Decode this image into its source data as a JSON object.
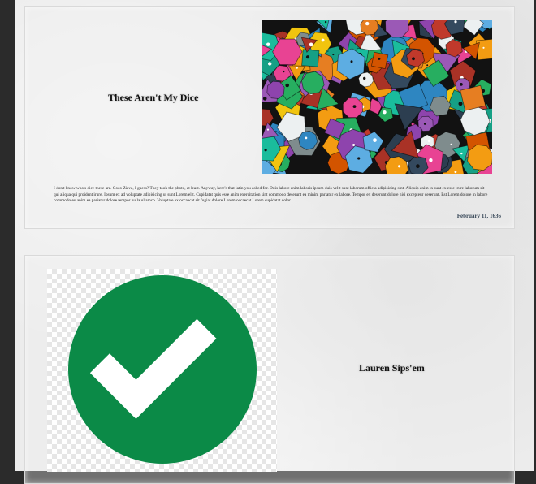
{
  "posts": [
    {
      "title": "These Aren't My Dice",
      "body": "I don't know who's dice these are. Coco Ziava, I guess? They took the photo, at least. Anyway, here's that latin you asked for. Duis labore enim laboris ipsum duis velit sunt laborum officia adipisicing sint. Aliquip anim in sunt ex esse irure laborum sit qui aliqua qui proident irure. Ipsum ex ad voluptate adipisicing ut sunt Lorem elit. Cupidatat quis esse anim exercitation sint commodo deserunt ea minim pariatur ex labore. Tempor ex deserunt dolore nisi excepteur deserunt. Est Lorem dolore in labore commodo eu anim ea pariatur dolore tempor nulla ullamco. Voluptate ex occaecat sit fugiat dolore Lorem occaecat Lorem cupidatat dolor.",
      "date": "February 11, 1636",
      "image_icon": "dice-photo"
    },
    {
      "title": "Lauren Sips'em",
      "image_icon": "checkmark-icon",
      "check_color": "#0b8a47"
    }
  ]
}
